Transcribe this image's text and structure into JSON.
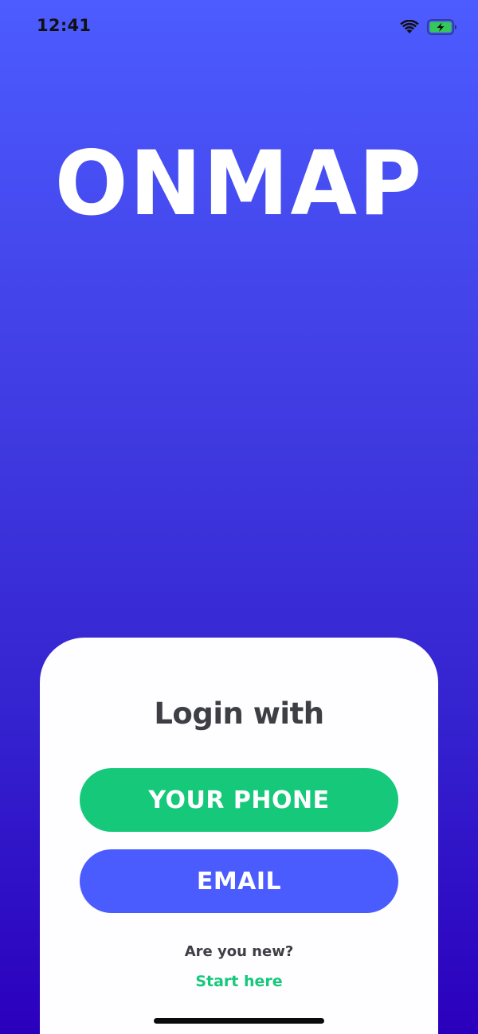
{
  "status_bar": {
    "time": "12:41",
    "wifi_icon": "wifi-icon",
    "battery_icon": "battery-charging-icon",
    "battery_color": "#34C759"
  },
  "logo": {
    "text": "ONMAP"
  },
  "login": {
    "title": "Login with",
    "phone_button_label": "YOUR PHONE",
    "email_button_label": "EMAIL",
    "new_user_text": "Are you new?",
    "start_link_label": "Start here"
  },
  "colors": {
    "background_top": "#4C5CFF",
    "background_bottom": "#2B00BD",
    "phone_button": "#16C97A",
    "email_button": "#4B5CFF",
    "card": "#FEFDFF",
    "text_dark": "#3E3E45",
    "link": "#16C97A"
  }
}
